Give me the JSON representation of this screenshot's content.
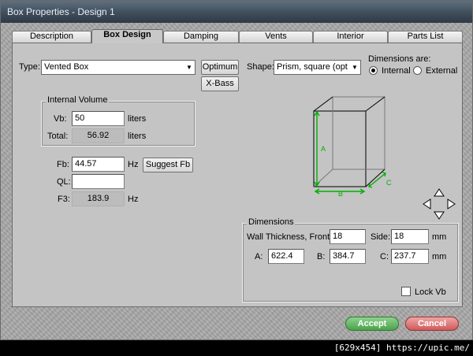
{
  "window": {
    "title": "Box Properties - Design 1"
  },
  "tabs": [
    {
      "label": "Description"
    },
    {
      "label": "Box Design"
    },
    {
      "label": "Damping"
    },
    {
      "label": "Vents"
    },
    {
      "label": "Interior"
    },
    {
      "label": "Parts List"
    }
  ],
  "type": {
    "label": "Type:",
    "value": "Vented Box",
    "optimum_label": "Optimum",
    "xbass_label": "X-Bass"
  },
  "shape": {
    "label": "Shape:",
    "value": "Prism, square (opt.)"
  },
  "dimensions_are": {
    "label": "Dimensions are:",
    "internal_label": "Internal",
    "external_label": "External",
    "selected": "Internal"
  },
  "internal_volume": {
    "title": "Internal Volume",
    "vb_label": "Vb:",
    "vb_value": "50",
    "vb_unit": "liters",
    "total_label": "Total:",
    "total_value": "56.92",
    "total_unit": "liters"
  },
  "tuning": {
    "fb_label": "Fb:",
    "fb_value": "44.57",
    "fb_unit": "Hz",
    "suggest_label": "Suggest Fb",
    "ql_label": "QL:",
    "ql_value": "",
    "f3_label": "F3:",
    "f3_value": "183.9",
    "f3_unit": "Hz"
  },
  "diagram": {
    "label_a": "A",
    "label_b": "B",
    "label_c": "C",
    "accent": "#00b000"
  },
  "dimensions": {
    "title": "Dimensions",
    "wall_label": "Wall Thickness, Front:",
    "front_value": "18",
    "side_label": "Side:",
    "side_value": "18",
    "mm1": "mm",
    "a_label": "A:",
    "a_value": "622.4",
    "b_label": "B:",
    "b_value": "384.7",
    "c_label": "C:",
    "c_value": "237.7",
    "mm2": "mm",
    "lock_label": "Lock Vb",
    "lock_checked": false
  },
  "actions": {
    "accept_label": "Accept",
    "cancel_label": "Cancel"
  },
  "footer": {
    "text": "[629x454] https://upic.me/"
  }
}
